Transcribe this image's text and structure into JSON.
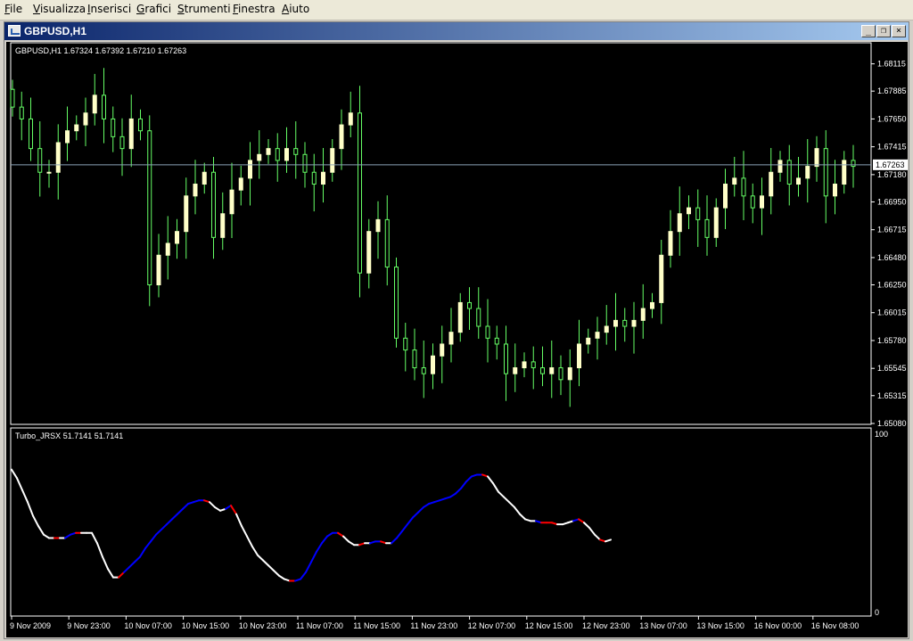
{
  "menu": [
    {
      "label": "File",
      "key": "F",
      "rest": "ile"
    },
    {
      "label": "Visualizza",
      "key": "V",
      "rest": "isualizza"
    },
    {
      "label": "Inserisci",
      "key": "I",
      "rest": "nserisci"
    },
    {
      "label": "Grafici",
      "key": "G",
      "rest": "rafici"
    },
    {
      "label": "Strumenti",
      "key": "S",
      "rest": "trumenti"
    },
    {
      "label": "Finestra",
      "key": "F",
      "rest": "inestra"
    },
    {
      "label": "Aiuto",
      "key": "A",
      "rest": "iuto"
    }
  ],
  "window": {
    "title": "GBPUSD,H1",
    "buttons": {
      "minimize": "_",
      "restore": "❐",
      "close": "×"
    }
  },
  "colors": {
    "background": "#000000",
    "bull_candle": "#ffffc8",
    "wick": "#66ff66",
    "price_line": "#8ca3b8",
    "indicator_up": "#0000ff",
    "indicator_down": "#ff0000",
    "indicator_flat": "#ffffff"
  },
  "price_panel": {
    "label": "GBPUSD,H1  1.67324 1.67392 1.67210 1.67263",
    "current_price": "1.67263",
    "price_ticks": [
      "1.68115",
      "1.67885",
      "1.67650",
      "1.67415",
      "1.67180",
      "1.66950",
      "1.66715",
      "1.66480",
      "1.66250",
      "1.66015",
      "1.65780",
      "1.65545",
      "1.65315",
      "1.65080"
    ]
  },
  "indicator_panel": {
    "label": "Turbo_JRSX 51.7141 51.7141",
    "ticks": [
      "100",
      "0"
    ]
  },
  "time_labels": [
    "9 Nov 2009",
    "9 Nov 23:00",
    "10 Nov 07:00",
    "10 Nov 15:00",
    "10 Nov 23:00",
    "11 Nov 07:00",
    "11 Nov 15:00",
    "11 Nov 23:00",
    "12 Nov 07:00",
    "12 Nov 15:00",
    "12 Nov 23:00",
    "13 Nov 07:00",
    "13 Nov 15:00",
    "16 Nov 00:00",
    "16 Nov 08:00"
  ],
  "chart_data": [
    {
      "type": "candlestick",
      "title": "GBPUSD,H1",
      "ylim": [
        1.6508,
        1.6824
      ],
      "ohlc_last": {
        "open": 1.67324,
        "high": 1.67392,
        "low": 1.6721,
        "close": 1.67263
      },
      "close": [
        1.6775,
        1.6765,
        1.674,
        1.672,
        1.672,
        1.6745,
        1.6755,
        1.676,
        1.677,
        1.6785,
        1.6765,
        1.675,
        1.674,
        1.6765,
        1.6755,
        1.6625,
        1.665,
        1.666,
        1.667,
        1.67,
        1.671,
        1.672,
        1.6665,
        1.6685,
        1.6705,
        1.6715,
        1.673,
        1.6735,
        1.674,
        1.673,
        1.674,
        1.6735,
        1.672,
        1.671,
        1.672,
        1.674,
        1.676,
        1.677,
        1.6635,
        1.667,
        1.668,
        1.664,
        1.658,
        1.657,
        1.6555,
        1.655,
        1.6565,
        1.6575,
        1.6585,
        1.661,
        1.6605,
        1.659,
        1.658,
        1.6575,
        1.655,
        1.6555,
        1.656,
        1.6555,
        1.655,
        1.6555,
        1.6545,
        1.6555,
        1.6575,
        1.658,
        1.6585,
        1.659,
        1.6595,
        1.659,
        1.6595,
        1.6605,
        1.661,
        1.665,
        1.667,
        1.6685,
        1.669,
        1.668,
        1.6665,
        1.669,
        1.671,
        1.6715,
        1.67,
        1.669,
        1.67,
        1.672,
        1.673,
        1.671,
        1.6715,
        1.6725,
        1.674,
        1.67,
        1.671,
        1.673,
        1.6725
      ],
      "xlabel": "",
      "ylabel": ""
    },
    {
      "type": "line",
      "title": "Turbo_JRSX",
      "ylim": [
        0,
        100
      ],
      "last_value": 51.7141,
      "x_index": [
        0,
        6,
        12,
        18,
        24,
        30,
        36,
        42,
        48,
        54,
        60,
        66,
        72,
        78,
        84,
        90,
        96,
        102,
        108,
        114,
        120,
        126,
        132,
        138,
        144,
        150,
        156,
        162,
        168,
        174,
        180,
        186,
        192,
        198,
        204,
        210,
        216,
        222,
        228,
        234,
        240,
        246,
        252,
        258,
        264,
        270,
        276,
        282,
        288,
        294,
        300,
        306,
        312,
        318,
        324,
        330,
        336,
        342,
        348,
        354,
        360,
        366,
        372,
        378,
        384,
        390,
        396,
        402,
        408,
        414,
        420,
        426,
        432,
        438,
        444,
        450,
        456,
        462,
        468,
        474,
        480,
        486,
        492,
        498,
        504,
        510,
        516,
        522,
        528,
        534,
        540,
        546,
        552,
        558,
        564,
        570,
        576,
        582,
        588,
        594,
        600,
        606,
        612,
        618,
        624,
        630,
        636,
        642,
        648,
        654,
        660,
        666,
        672,
        678,
        684,
        690,
        696,
        702,
        708,
        714,
        720,
        726,
        732,
        738,
        744,
        750,
        756,
        762,
        768,
        774,
        780,
        786,
        792,
        798,
        804,
        810,
        816,
        822,
        828,
        834,
        840,
        846,
        852,
        858,
        864,
        870,
        876,
        882,
        888,
        894,
        900,
        906,
        912,
        918,
        924,
        930,
        936,
        942,
        948,
        954
      ],
      "values": [
        84,
        79,
        72,
        65,
        57,
        51,
        46,
        44,
        44,
        44,
        44,
        46,
        47,
        47,
        47,
        47,
        41,
        33,
        26,
        21,
        21,
        24,
        27,
        30,
        33,
        38,
        42,
        46,
        49,
        52,
        55,
        58,
        61,
        64,
        65,
        66,
        66,
        65,
        62,
        60,
        61,
        63,
        58,
        51,
        45,
        39,
        34,
        31,
        28,
        25,
        22,
        20,
        19,
        19,
        20,
        24,
        30,
        36,
        41,
        45,
        47,
        47,
        45,
        42,
        40,
        40,
        41,
        41,
        42,
        42,
        41,
        41,
        44,
        48,
        52,
        56,
        59,
        62,
        64,
        65,
        66,
        67,
        68,
        70,
        73,
        77,
        80,
        81,
        81,
        80,
        76,
        71,
        68,
        65,
        62,
        58,
        55,
        54,
        54,
        53,
        53,
        53,
        52,
        52,
        53,
        54,
        55,
        53,
        50,
        46,
        43,
        42,
        43
      ],
      "direction": [
        "flat",
        "flat",
        "flat",
        "flat",
        "flat",
        "flat",
        "flat",
        "flat",
        "down",
        "flat",
        "up",
        "up",
        "down",
        "flat",
        "flat",
        "flat",
        "flat",
        "flat",
        "flat",
        "flat",
        "down",
        "up",
        "up",
        "up",
        "up",
        "up",
        "up",
        "up",
        "up",
        "up",
        "up",
        "up",
        "up",
        "up",
        "up",
        "up",
        "down",
        "flat",
        "flat",
        "flat",
        "up",
        "down",
        "flat",
        "flat",
        "flat",
        "flat",
        "flat",
        "flat",
        "flat",
        "flat",
        "flat",
        "flat",
        "down",
        "up",
        "up",
        "up",
        "up",
        "up",
        "up",
        "up",
        "up",
        "down",
        "flat",
        "flat",
        "flat",
        "down",
        "flat",
        "up",
        "up",
        "down",
        "flat",
        "up",
        "up",
        "up",
        "up",
        "up",
        "up",
        "up",
        "up",
        "up",
        "up",
        "up",
        "up",
        "up",
        "up",
        "up",
        "up",
        "up",
        "down",
        "flat",
        "flat",
        "flat",
        "flat",
        "flat",
        "flat",
        "flat",
        "flat",
        "flat",
        "up",
        "down",
        "down",
        "down",
        "flat",
        "flat",
        "flat",
        "up",
        "down",
        "flat",
        "flat",
        "flat",
        "down"
      ]
    }
  ]
}
